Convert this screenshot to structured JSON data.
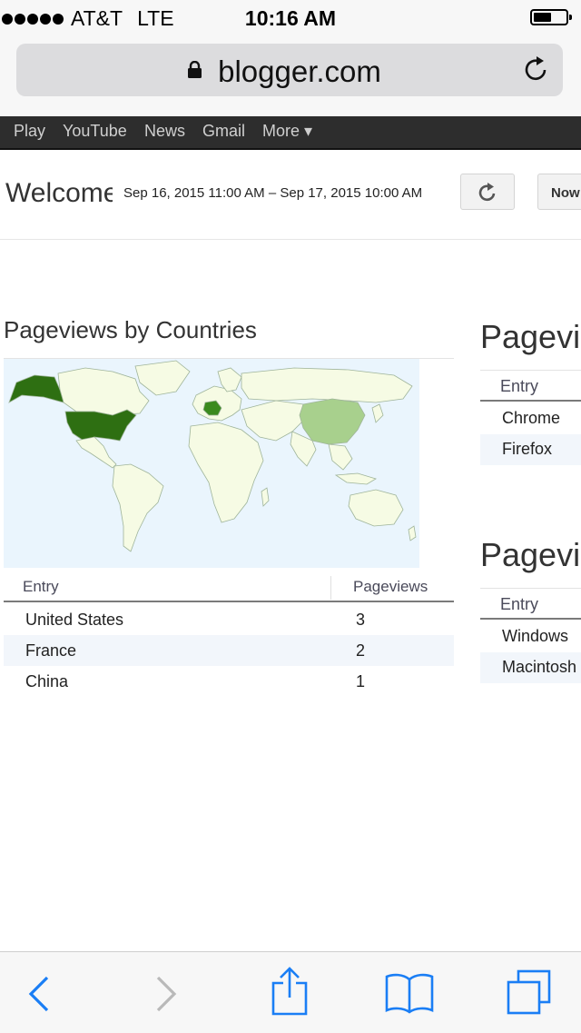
{
  "status_bar": {
    "carrier": "AT&T",
    "network": "LTE",
    "time": "10:16 AM",
    "battery_level": 0.55,
    "signal_bars": 5
  },
  "browser": {
    "url": "blogger.com",
    "icons": [
      "lock-icon",
      "reload-icon"
    ]
  },
  "google_bar": {
    "links": [
      "Play",
      "YouTube",
      "News",
      "Gmail",
      "More ▾"
    ]
  },
  "header": {
    "welcome": "Welcome",
    "date_range": "Sep 16, 2015 11:00 AM – Sep 17, 2015 10:00 AM",
    "now_label": "Now"
  },
  "countries_panel": {
    "title": "Pageviews by Countries",
    "headers": {
      "entry": "Entry",
      "pageviews": "Pageviews"
    },
    "rows": [
      {
        "entry": "United States",
        "pageviews": "3"
      },
      {
        "entry": "France",
        "pageviews": "2"
      },
      {
        "entry": "China",
        "pageviews": "1"
      }
    ],
    "map_colors": {
      "high": "#2e6f12",
      "mid": "#3a8a1e",
      "low": "#a8d08d",
      "none": "#f6fbe4",
      "water": "#eaf5fd"
    }
  },
  "browsers_panel": {
    "title": "Pagevie",
    "header": "Entry",
    "rows": [
      "Chrome",
      "Firefox"
    ]
  },
  "os_panel": {
    "title": "Pagevie",
    "header": "Entry",
    "rows": [
      "Windows",
      "Macintosh"
    ]
  },
  "toolbar": {
    "icons": [
      "back-icon",
      "forward-icon",
      "share-icon",
      "bookmarks-icon",
      "tabs-icon"
    ],
    "accent": "#1a7ef5",
    "disabled": "#b9b9b9"
  }
}
